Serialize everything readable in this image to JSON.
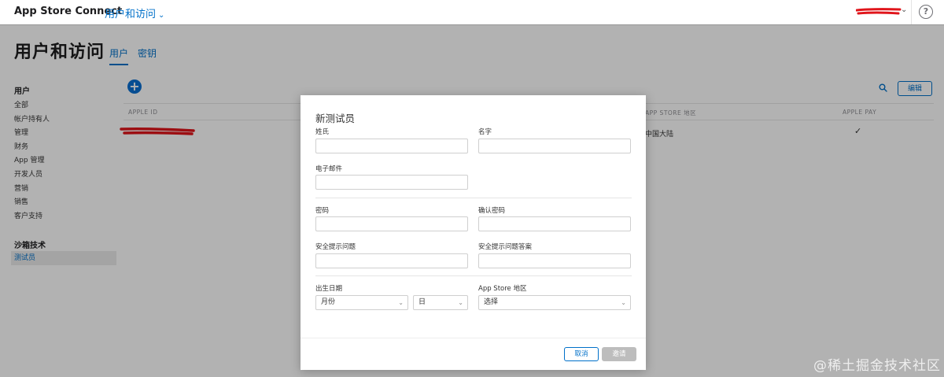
{
  "topbar": {
    "app_name": "App Store Connect",
    "section": "用户和访问",
    "help_glyph": "?"
  },
  "header": {
    "title": "用户和访问",
    "tabs": [
      {
        "label": "用户",
        "active": true
      },
      {
        "label": "密钥",
        "active": false
      }
    ]
  },
  "sidebar": {
    "group1_title": "用户",
    "group1_items": [
      "全部",
      "帐户持有人",
      "管理",
      "财务",
      "App 管理",
      "开发人员",
      "营销",
      "销售",
      "客户支持"
    ],
    "group2_title": "沙箱技术",
    "group2_items": [
      "测试员"
    ]
  },
  "content": {
    "add_glyph": "+",
    "edit_label": "编辑",
    "columns": [
      "APPLE ID",
      "APP STORE 地区",
      "APPLE PAY"
    ],
    "row": {
      "region": "中国大陆",
      "apple_pay": "✓"
    }
  },
  "modal": {
    "title": "新测试员",
    "last_name_label": "姓氏",
    "first_name_label": "名字",
    "email_label": "电子邮件",
    "password_label": "密码",
    "confirm_password_label": "确认密码",
    "security_question_label": "安全提示问题",
    "security_answer_label": "安全提示问题答案",
    "dob_label": "出生日期",
    "month_value": "月份",
    "day_value": "日",
    "region_label": "App Store 地区",
    "region_value": "选择",
    "cancel_label": "取消",
    "invite_label": "邀请"
  },
  "watermark": "@稀土掘金技术社区",
  "colors": {
    "accent": "#0070c9",
    "redaction": "#e0151b",
    "disabled": "#bdbdbd"
  }
}
